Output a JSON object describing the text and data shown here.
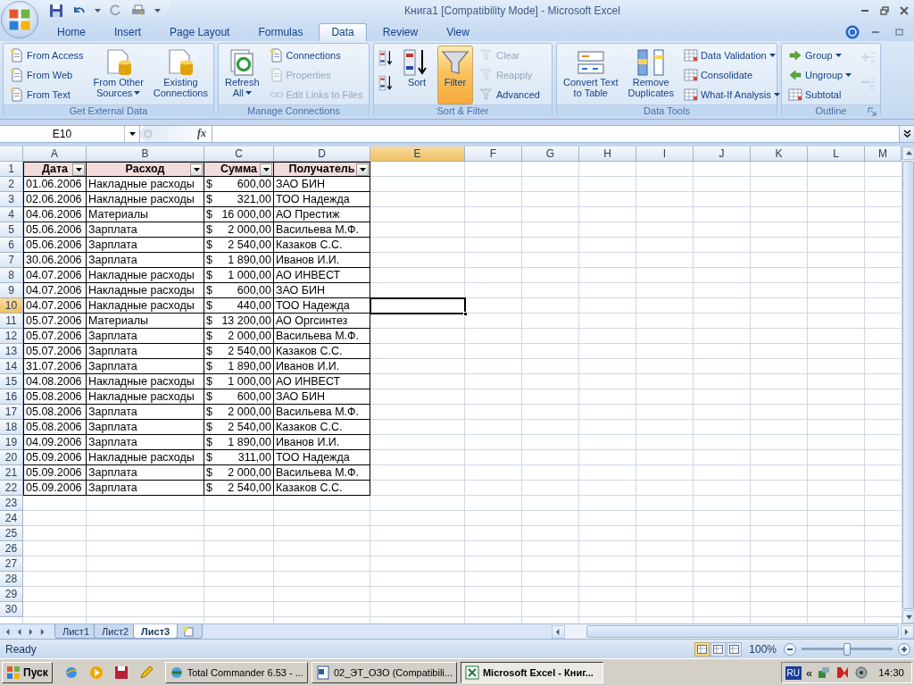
{
  "window": {
    "title": "Книга1  [Compatibility Mode] - Microsoft Excel"
  },
  "ribbon_tabs": [
    {
      "label": "Home",
      "selected": false
    },
    {
      "label": "Insert",
      "selected": false
    },
    {
      "label": "Page Layout",
      "selected": false
    },
    {
      "label": "Formulas",
      "selected": false
    },
    {
      "label": "Data",
      "selected": true
    },
    {
      "label": "Review",
      "selected": false
    },
    {
      "label": "View",
      "selected": false
    }
  ],
  "ribbon_groups": [
    {
      "label": "Get External Data",
      "launcher": false,
      "columns": [
        [
          {
            "kind": "small",
            "label": "From Access",
            "disabled": false,
            "on": false,
            "menu": false
          },
          {
            "kind": "small",
            "label": "From Web",
            "disabled": false,
            "on": false,
            "menu": false
          },
          {
            "kind": "small",
            "label": "From Text",
            "disabled": false,
            "on": false,
            "menu": false
          }
        ],
        [
          {
            "kind": "large",
            "lines": [
              "From Other",
              "Sources"
            ],
            "disabled": false,
            "on": false,
            "menu": true
          }
        ],
        [
          {
            "kind": "large",
            "lines": [
              "Existing",
              "Connections"
            ],
            "disabled": false,
            "on": false,
            "menu": false
          }
        ]
      ]
    },
    {
      "label": "Manage Connections",
      "launcher": false,
      "columns": [
        [
          {
            "kind": "large",
            "lines": [
              "Refresh",
              "All"
            ],
            "disabled": false,
            "on": false,
            "menu": true
          }
        ],
        [
          {
            "kind": "small",
            "label": "Connections",
            "disabled": false,
            "on": false,
            "menu": false
          },
          {
            "kind": "small",
            "label": "Properties",
            "disabled": true,
            "on": false,
            "menu": false
          },
          {
            "kind": "small",
            "label": "Edit Links to Files",
            "disabled": true,
            "on": false,
            "menu": false
          }
        ]
      ]
    },
    {
      "label": "Sort & Filter",
      "launcher": false,
      "columns": [
        [
          {
            "kind": "icon",
            "disabled": false,
            "on": false,
            "menu": false
          },
          {
            "kind": "icon",
            "disabled": false,
            "on": false,
            "menu": false
          }
        ],
        [
          {
            "kind": "large",
            "lines": [
              "Sort"
            ],
            "disabled": false,
            "on": false,
            "menu": false
          }
        ],
        [
          {
            "kind": "large",
            "lines": [
              "Filter"
            ],
            "disabled": false,
            "on": true,
            "menu": false
          }
        ],
        [
          {
            "kind": "small",
            "label": "Clear",
            "disabled": true,
            "on": false,
            "menu": false
          },
          {
            "kind": "small",
            "label": "Reapply",
            "disabled": true,
            "on": false,
            "menu": false
          },
          {
            "kind": "small",
            "label": "Advanced",
            "disabled": false,
            "on": false,
            "menu": false
          }
        ]
      ]
    },
    {
      "label": "Data Tools",
      "launcher": false,
      "columns": [
        [
          {
            "kind": "large",
            "lines": [
              "Convert Text",
              "to Table"
            ],
            "disabled": false,
            "on": false,
            "menu": false
          }
        ],
        [
          {
            "kind": "large",
            "lines": [
              "Remove",
              "Duplicates"
            ],
            "disabled": false,
            "on": false,
            "menu": false
          }
        ],
        [
          {
            "kind": "small",
            "label": "Data Validation",
            "disabled": false,
            "on": false,
            "menu": true
          },
          {
            "kind": "small",
            "label": "Consolidate",
            "disabled": false,
            "on": false,
            "menu": false
          },
          {
            "kind": "small",
            "label": "What-If Analysis",
            "disabled": false,
            "on": false,
            "menu": true
          }
        ]
      ]
    },
    {
      "label": "Outline",
      "launcher": true,
      "columns": [
        [
          {
            "kind": "small",
            "label": "Group",
            "disabled": false,
            "on": false,
            "menu": true
          },
          {
            "kind": "small",
            "label": "Ungroup",
            "disabled": false,
            "on": false,
            "menu": true
          },
          {
            "kind": "small",
            "label": "Subtotal",
            "disabled": false,
            "on": false,
            "menu": false
          }
        ],
        [
          {
            "kind": "icon",
            "disabled": true,
            "on": false,
            "menu": false
          },
          {
            "kind": "icon",
            "disabled": true,
            "on": false,
            "menu": false
          }
        ]
      ]
    }
  ],
  "formula_bar": {
    "name_box": "E10",
    "fx_label": "fx"
  },
  "columns": [
    {
      "label": "A",
      "selected": false
    },
    {
      "label": "B",
      "selected": false
    },
    {
      "label": "C",
      "selected": false
    },
    {
      "label": "D",
      "selected": false
    },
    {
      "label": "E",
      "selected": true
    },
    {
      "label": "F",
      "selected": false
    },
    {
      "label": "G",
      "selected": false
    },
    {
      "label": "H",
      "selected": false
    },
    {
      "label": "I",
      "selected": false
    },
    {
      "label": "J",
      "selected": false
    },
    {
      "label": "K",
      "selected": false
    },
    {
      "label": "L",
      "selected": false
    },
    {
      "label": "M",
      "selected": false
    }
  ],
  "rows": [
    {
      "label": "1",
      "selected": false
    },
    {
      "label": "2",
      "selected": false
    },
    {
      "label": "3",
      "selected": false
    },
    {
      "label": "4",
      "selected": false
    },
    {
      "label": "5",
      "selected": false
    },
    {
      "label": "6",
      "selected": false
    },
    {
      "label": "7",
      "selected": false
    },
    {
      "label": "8",
      "selected": false
    },
    {
      "label": "9",
      "selected": false
    },
    {
      "label": "10",
      "selected": true
    },
    {
      "label": "11",
      "selected": false
    },
    {
      "label": "12",
      "selected": false
    },
    {
      "label": "13",
      "selected": false
    },
    {
      "label": "14",
      "selected": false
    },
    {
      "label": "15",
      "selected": false
    },
    {
      "label": "16",
      "selected": false
    },
    {
      "label": "17",
      "selected": false
    },
    {
      "label": "18",
      "selected": false
    },
    {
      "label": "19",
      "selected": false
    },
    {
      "label": "20",
      "selected": false
    },
    {
      "label": "21",
      "selected": false
    },
    {
      "label": "22",
      "selected": false
    },
    {
      "label": "23",
      "selected": false
    },
    {
      "label": "24",
      "selected": false
    },
    {
      "label": "25",
      "selected": false
    },
    {
      "label": "26",
      "selected": false
    },
    {
      "label": "27",
      "selected": false
    },
    {
      "label": "28",
      "selected": false
    },
    {
      "label": "29",
      "selected": false
    },
    {
      "label": "30",
      "selected": false
    }
  ],
  "table": {
    "header": [
      "Дата",
      "Расход",
      "Сумма",
      "Получатель"
    ],
    "rows": [
      [
        "01.06.2006",
        "Накладные расходы",
        {
          "currency": "$",
          "amount": "600,00"
        },
        "ЗАО БИН"
      ],
      [
        "02.06.2006",
        "Накладные расходы",
        {
          "currency": "$",
          "amount": "321,00"
        },
        "ТОО Надежда"
      ],
      [
        "04.06.2006",
        "Материалы",
        {
          "currency": "$",
          "amount": "16 000,00"
        },
        "АО Престиж"
      ],
      [
        "05.06.2006",
        "Зарплата",
        {
          "currency": "$",
          "amount": "2 000,00"
        },
        "Васильева М.Ф."
      ],
      [
        "05.06.2006",
        "Зарплата",
        {
          "currency": "$",
          "amount": "2 540,00"
        },
        "Казаков С.С."
      ],
      [
        "30.06.2006",
        "Зарплата",
        {
          "currency": "$",
          "amount": "1 890,00"
        },
        "Иванов И.И."
      ],
      [
        "04.07.2006",
        "Накладные расходы",
        {
          "currency": "$",
          "amount": "1 000,00"
        },
        "АО ИНВЕСТ"
      ],
      [
        "04.07.2006",
        "Накладные расходы",
        {
          "currency": "$",
          "amount": "600,00"
        },
        "ЗАО БИН"
      ],
      [
        "04.07.2006",
        "Накладные расходы",
        {
          "currency": "$",
          "amount": "440,00"
        },
        "ТОО Надежда"
      ],
      [
        "05.07.2006",
        "Материалы",
        {
          "currency": "$",
          "amount": "13 200,00"
        },
        "АО Оргсинтез"
      ],
      [
        "05.07.2006",
        "Зарплата",
        {
          "currency": "$",
          "amount": "2 000,00"
        },
        "Васильева М.Ф."
      ],
      [
        "05.07.2006",
        "Зарплата",
        {
          "currency": "$",
          "amount": "2 540,00"
        },
        "Казаков С.С."
      ],
      [
        "31.07.2006",
        "Зарплата",
        {
          "currency": "$",
          "amount": "1 890,00"
        },
        "Иванов И.И."
      ],
      [
        "04.08.2006",
        "Накладные расходы",
        {
          "currency": "$",
          "amount": "1 000,00"
        },
        "АО ИНВЕСТ"
      ],
      [
        "05.08.2006",
        "Накладные расходы",
        {
          "currency": "$",
          "amount": "600,00"
        },
        "ЗАО БИН"
      ],
      [
        "05.08.2006",
        "Зарплата",
        {
          "currency": "$",
          "amount": "2 000,00"
        },
        "Васильева М.Ф."
      ],
      [
        "05.08.2006",
        "Зарплата",
        {
          "currency": "$",
          "amount": "2 540,00"
        },
        "Казаков С.С."
      ],
      [
        "04.09.2006",
        "Зарплата",
        {
          "currency": "$",
          "amount": "1 890,00"
        },
        "Иванов И.И."
      ],
      [
        "05.09.2006",
        "Накладные расходы",
        {
          "currency": "$",
          "amount": "311,00"
        },
        "ТОО Надежда"
      ],
      [
        "05.09.2006",
        "Зарплата",
        {
          "currency": "$",
          "amount": "2 000,00"
        },
        "Васильева М.Ф."
      ],
      [
        "05.09.2006",
        "Зарплата",
        {
          "currency": "$",
          "amount": "2 540,00"
        },
        "Казаков С.С."
      ]
    ]
  },
  "sheet_tabs": [
    {
      "label": "Лист1",
      "selected": false
    },
    {
      "label": "Лист2",
      "selected": false
    },
    {
      "label": "Лист3",
      "selected": true
    }
  ],
  "status_bar": {
    "status": "Ready",
    "views": [
      {
        "selected": true
      },
      {
        "selected": false
      },
      {
        "selected": false
      }
    ],
    "zoom": "100%",
    "zoom_level": {
      "level": 0.5
    }
  },
  "taskbar": {
    "start": "Пуск",
    "tasks": [
      {
        "label": "Total Commander 6.53 - ...",
        "selected": false
      },
      {
        "label": "02_ЭТ_ОЗО (Compatibili...",
        "selected": false
      },
      {
        "label": "Microsoft Excel - Книг...",
        "selected": true
      }
    ],
    "language": "RU",
    "tray_toggle": "«",
    "clock": "14:30"
  }
}
